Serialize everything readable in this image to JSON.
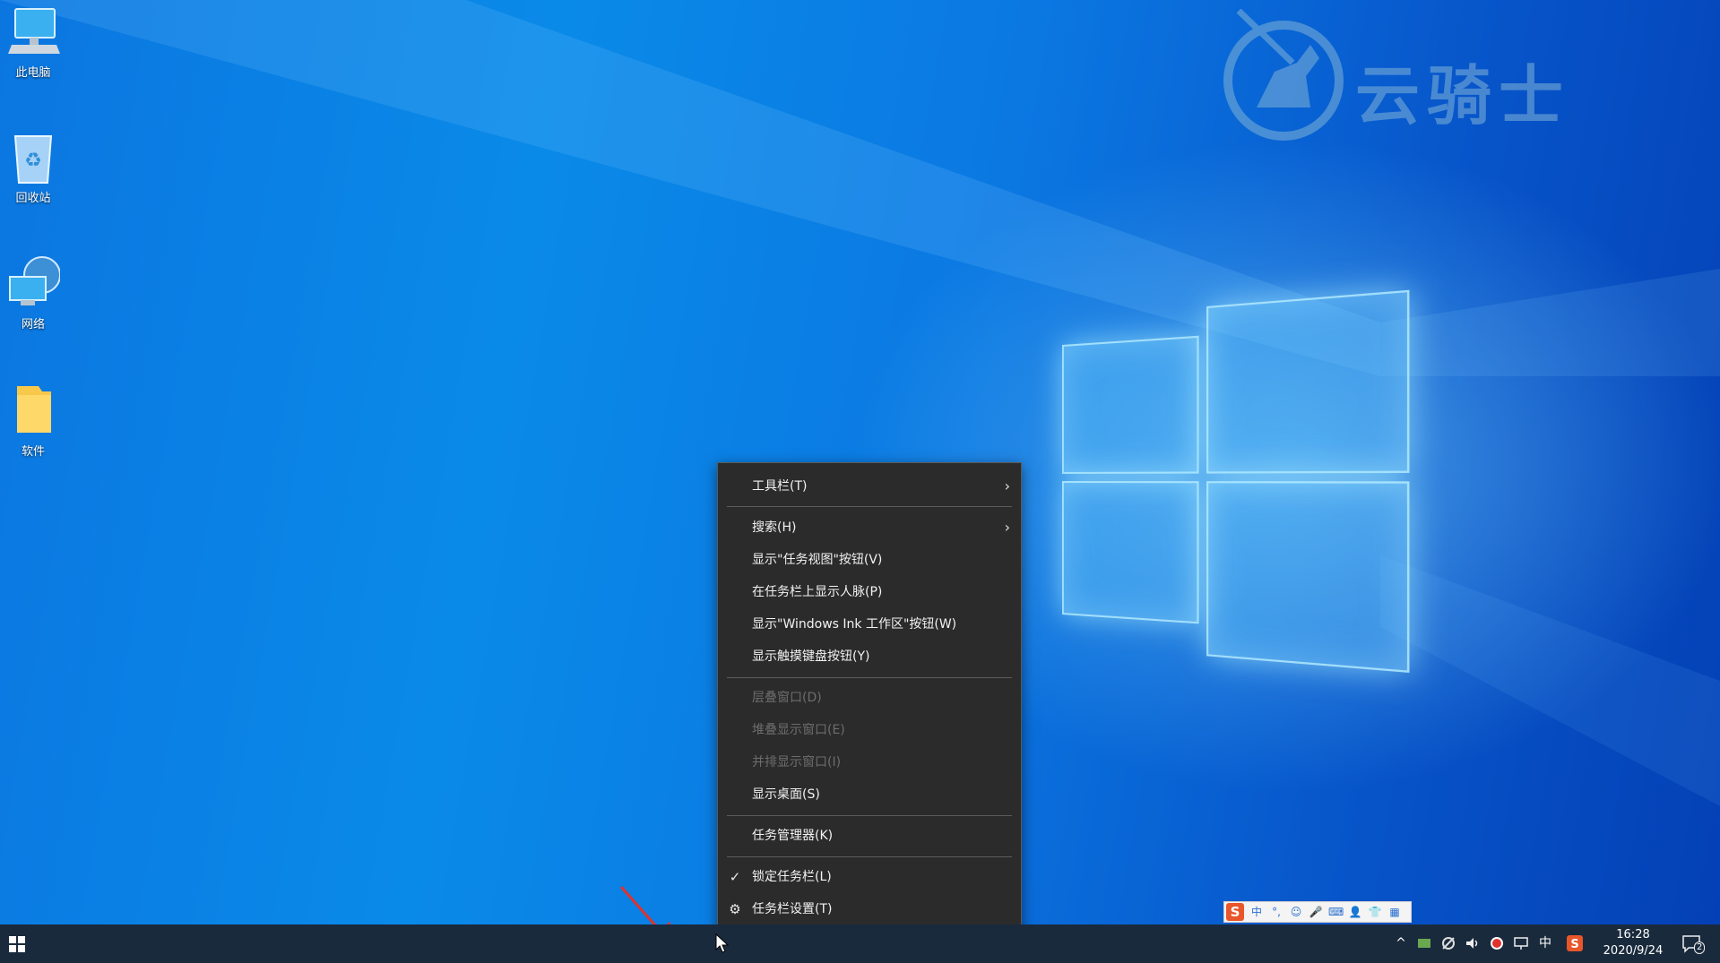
{
  "desktop": {
    "icons": [
      {
        "label": "此电脑",
        "icon": "this-pc-icon"
      },
      {
        "label": "回收站",
        "icon": "recycle-bin-icon"
      },
      {
        "label": "网络",
        "icon": "network-icon"
      },
      {
        "label": "软件",
        "icon": "folder-icon"
      }
    ],
    "watermark": {
      "text": "云骑士"
    }
  },
  "context_menu": {
    "items": [
      {
        "label": "工具栏(T)",
        "submenu": true,
        "enabled": true
      },
      {
        "label": "搜索(H)",
        "submenu": true,
        "enabled": true
      },
      {
        "label": "显示\"任务视图\"按钮(V)",
        "enabled": true
      },
      {
        "label": "在任务栏上显示人脉(P)",
        "enabled": true
      },
      {
        "label": "显示\"Windows Ink 工作区\"按钮(W)",
        "enabled": true
      },
      {
        "label": "显示触摸键盘按钮(Y)",
        "enabled": true
      },
      {
        "label": "层叠窗口(D)",
        "enabled": false
      },
      {
        "label": "堆叠显示窗口(E)",
        "enabled": false
      },
      {
        "label": "并排显示窗口(I)",
        "enabled": false
      },
      {
        "label": "显示桌面(S)",
        "enabled": true
      },
      {
        "label": "任务管理器(K)",
        "enabled": true
      },
      {
        "label": "锁定任务栏(L)",
        "checked": true,
        "enabled": true
      },
      {
        "label": "任务栏设置(T)",
        "icon": "gear-icon",
        "enabled": true
      }
    ],
    "chevron": "›",
    "checkmark": "✓",
    "gear": "⚙"
  },
  "ime_bar": {
    "logo": "S",
    "items": [
      "中",
      "°,",
      "☺",
      "🎤",
      "⌨",
      "👤",
      "👕",
      "▦"
    ]
  },
  "taskbar": {
    "start_icon": "windows-start-icon",
    "tray": {
      "chevron": "^",
      "icons": [
        "nvidia-icon",
        "network-icon",
        "volume-icon",
        "record-icon",
        "display-icon"
      ],
      "ime_label": "中",
      "sogou_icon": "sogou-icon",
      "time": "16:28",
      "date": "2020/9/24",
      "notification_count": "2"
    }
  },
  "colors": {
    "accent_arrow": "#e0322b",
    "menu_bg": "#2b2b2b",
    "taskbar_bg": "#1a2a3d"
  }
}
